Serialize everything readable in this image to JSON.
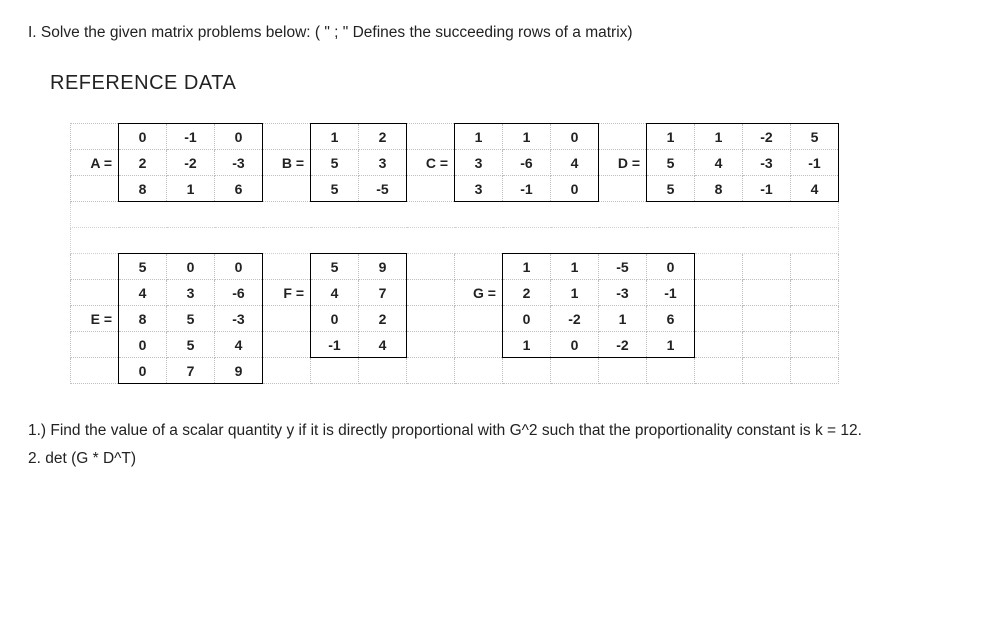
{
  "title": "I. Solve the given matrix problems below: ( \" ; \" Defines the succeeding rows of a matrix)",
  "ref_title": "REFERENCE DATA",
  "labels": {
    "A": "A =",
    "B": "B =",
    "C": "C =",
    "D": "D =",
    "E": "E =",
    "F": "F =",
    "G": "G ="
  },
  "A": [
    [
      "0",
      "-1",
      "0"
    ],
    [
      "2",
      "-2",
      "-3"
    ],
    [
      "8",
      "1",
      "6"
    ]
  ],
  "B": [
    [
      "1",
      "2"
    ],
    [
      "5",
      "3"
    ],
    [
      "5",
      "-5"
    ]
  ],
  "C": [
    [
      "1",
      "1",
      "0"
    ],
    [
      "3",
      "-6",
      "4"
    ],
    [
      "3",
      "-1",
      "0"
    ]
  ],
  "D": [
    [
      "1",
      "1",
      "-2",
      "5"
    ],
    [
      "5",
      "4",
      "-3",
      "-1"
    ],
    [
      "5",
      "8",
      "-1",
      "4"
    ]
  ],
  "E": [
    [
      "5",
      "0",
      "0"
    ],
    [
      "4",
      "3",
      "-6"
    ],
    [
      "8",
      "5",
      "-3"
    ],
    [
      "0",
      "5",
      "4"
    ],
    [
      "0",
      "7",
      "9"
    ]
  ],
  "F": [
    [
      "5",
      "9"
    ],
    [
      "4",
      "7"
    ],
    [
      "0",
      "2"
    ],
    [
      "-1",
      "4"
    ]
  ],
  "G": [
    [
      "1",
      "1",
      "-5",
      "0"
    ],
    [
      "2",
      "1",
      "-3",
      "-1"
    ],
    [
      "0",
      "-2",
      "1",
      "6"
    ],
    [
      "1",
      "0",
      "-2",
      "1"
    ]
  ],
  "q1": "1.) Find the value of a scalar quantity y if it is directly proportional  with G^2 such that the proportionality  constant is k = 12.",
  "q2": "2. det (G * D^T)"
}
